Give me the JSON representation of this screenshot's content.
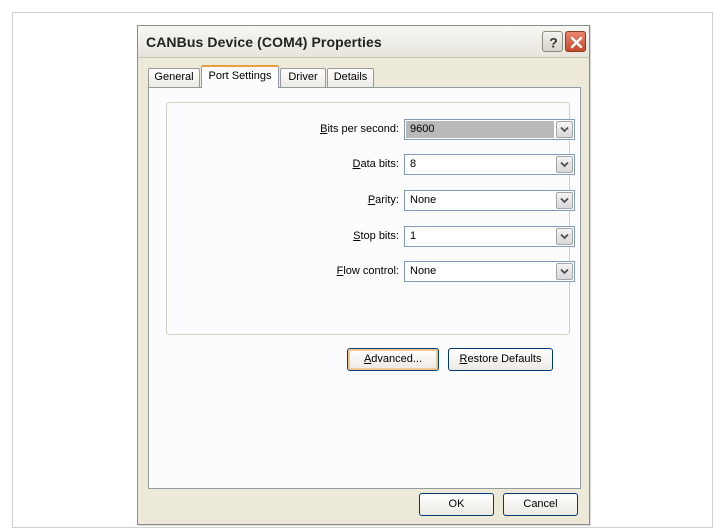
{
  "window": {
    "title": "CANBus Device (COM4) Properties",
    "help_glyph": "?",
    "close_glyph": "✕"
  },
  "tabs": [
    {
      "label": "General",
      "active": false
    },
    {
      "label": "Port Settings",
      "active": true
    },
    {
      "label": "Driver",
      "active": false
    },
    {
      "label": "Details",
      "active": false
    }
  ],
  "fields": {
    "bits_per_second": {
      "accel": "B",
      "rest": "its per second:",
      "value": "9600"
    },
    "data_bits": {
      "accel": "D",
      "rest": "ata bits:",
      "value": "8"
    },
    "parity": {
      "accel": "P",
      "rest": "arity:",
      "value": "None"
    },
    "stop_bits": {
      "accel": "S",
      "rest": "top bits:",
      "value": "1"
    },
    "flow_control": {
      "accel": "F",
      "rest": "low control:",
      "value": "None"
    }
  },
  "buttons": {
    "advanced": {
      "accel": "A",
      "rest": "dvanced..."
    },
    "restore": {
      "accel": "R",
      "rest": "estore Defaults"
    },
    "ok": "OK",
    "cancel": "Cancel"
  },
  "colors": {
    "dialog_bg": "#ece9d8",
    "panel_bg": "#fcfcfe",
    "close_red": "#c84a2e",
    "tab_accent": "#e8a040"
  }
}
